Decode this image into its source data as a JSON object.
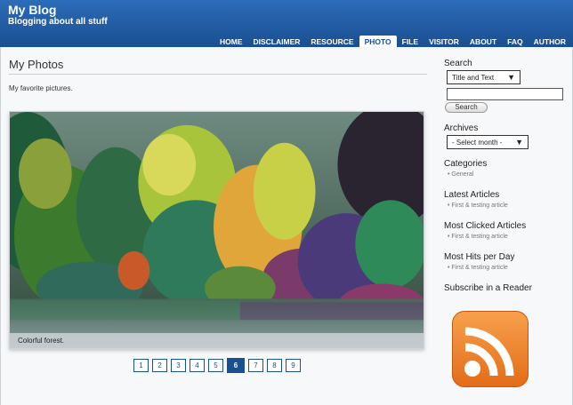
{
  "header": {
    "title": "My Blog",
    "subtitle": "Blogging about all stuff",
    "nav": [
      {
        "label": "HOME",
        "active": false
      },
      {
        "label": "DISCLAIMER",
        "active": false
      },
      {
        "label": "RESOURCE",
        "active": false
      },
      {
        "label": "PHOTO",
        "active": true
      },
      {
        "label": "FILE",
        "active": false
      },
      {
        "label": "VISITOR",
        "active": false
      },
      {
        "label": "ABOUT",
        "active": false
      },
      {
        "label": "FAQ",
        "active": false
      },
      {
        "label": "AUTHOR",
        "active": false
      }
    ]
  },
  "main": {
    "title": "My Photos",
    "intro": "My favorite pictures.",
    "caption": "Colorful forest.",
    "pages": [
      "1",
      "2",
      "3",
      "4",
      "5",
      "6",
      "7",
      "8",
      "9"
    ],
    "current_page": "6"
  },
  "sidebar": {
    "search_heading": "Search",
    "search_scope": "Title and Text",
    "search_button": "Search",
    "archives_heading": "Archives",
    "archives_select": "- Select month -",
    "categories_heading": "Categories",
    "categories": [
      "General"
    ],
    "latest_heading": "Latest Articles",
    "latest": [
      "First & testing article"
    ],
    "most_clicked_heading": "Most Clicked Articles",
    "most_clicked": [
      "First & testing article"
    ],
    "most_hits_heading": "Most Hits per Day",
    "most_hits": [
      "First & testing article"
    ],
    "subscribe_heading": "Subscribe in a Reader"
  }
}
